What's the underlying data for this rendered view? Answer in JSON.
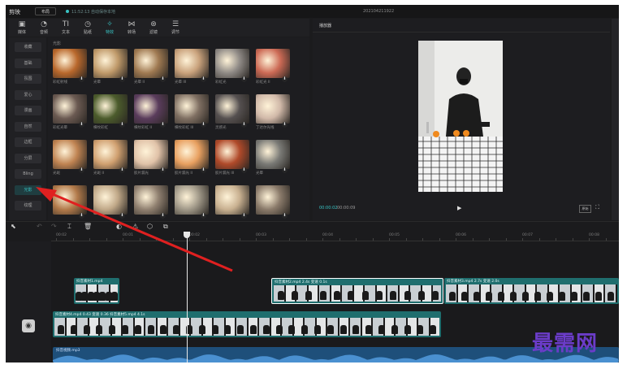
{
  "titlebar": {
    "app_name": "剪映",
    "layout_label": "布局",
    "autosave": "11:52:13 自动保存本地",
    "project_title": "202104211922"
  },
  "toolbar": {
    "tools": [
      {
        "label": "媒体",
        "icon": "media-icon",
        "glyph": "▣"
      },
      {
        "label": "音频",
        "icon": "audio-icon",
        "glyph": "◔"
      },
      {
        "label": "文本",
        "icon": "text-icon",
        "glyph": "TI"
      },
      {
        "label": "贴纸",
        "icon": "sticker-icon",
        "glyph": "◷"
      },
      {
        "label": "特效",
        "icon": "effects-icon",
        "glyph": "✧",
        "active": true
      },
      {
        "label": "转场",
        "icon": "transition-icon",
        "glyph": "⋈"
      },
      {
        "label": "滤镜",
        "icon": "filter-icon",
        "glyph": "⊛"
      },
      {
        "label": "调节",
        "icon": "adjust-icon",
        "glyph": "☰"
      }
    ]
  },
  "sidebar": {
    "items": [
      "收藏",
      "基础",
      "氛围",
      "爱心",
      "漫画",
      "自然",
      "边框",
      "分屏",
      "Bling",
      "光影",
      "纹理"
    ],
    "active": "光影"
  },
  "effects": {
    "section": "光影",
    "items": [
      {
        "label": "彩虹射线",
        "color": "#b9682c"
      },
      {
        "label": "光晕",
        "color": "#c09a6a"
      },
      {
        "label": "光晕 II",
        "color": "#a07a52"
      },
      {
        "label": "光晕 III",
        "color": "#c9a27c"
      },
      {
        "label": "彩虹光",
        "color": "#8f8a86"
      },
      {
        "label": "彩虹光 II",
        "color": "#cc6a55"
      },
      {
        "label": "彩虹光晕",
        "color": "#6b5a52"
      },
      {
        "label": "横纹彩虹",
        "color": "#4c5c2c"
      },
      {
        "label": "横纹彩虹 II",
        "color": "#5a3c5c"
      },
      {
        "label": "横纹彩虹 III",
        "color": "#7f6f62"
      },
      {
        "label": "灵感光",
        "color": "#555050"
      },
      {
        "label": "丁达尔光线",
        "color": "#d0b8a8"
      },
      {
        "label": "光斑",
        "color": "#c08452"
      },
      {
        "label": "光斑 II",
        "color": "#d0a070"
      },
      {
        "label": "胶片漏光",
        "color": "#e0c2a8"
      },
      {
        "label": "胶片漏光 II",
        "color": "#e8a060"
      },
      {
        "label": "胶片漏光 III",
        "color": "#b04a2a"
      },
      {
        "label": "光晕",
        "color": "#7a7a76"
      },
      {
        "label": "",
        "color": "#b27a4a"
      },
      {
        "label": "",
        "color": "#c0a888"
      },
      {
        "label": "",
        "color": "#908070"
      },
      {
        "label": "",
        "color": "#a09888"
      },
      {
        "label": "",
        "color": "#c8b090"
      },
      {
        "label": "",
        "color": "#8a7a6a"
      }
    ]
  },
  "player": {
    "title": "播放器",
    "current_time": "00:00:02",
    "total_time": "00:00:09",
    "ratio_label": "原始"
  },
  "timeline": {
    "ruler": [
      "00:02",
      "00:01",
      "00:02",
      "00:03",
      "00:04",
      "00:05",
      "00:06",
      "00:07",
      "00:08"
    ],
    "main_clips": [
      {
        "label": "抖音素材1.mp4",
        "frames": 7
      },
      {
        "label": "抖音素材2.mp4  2.4s  变速 0.1s",
        "frames": 12,
        "selected": true
      },
      {
        "label": "抖音素材3.mp4  2.7s  变速 2.0s",
        "frames": 14
      }
    ],
    "lower_clip": {
      "label": "抖音素材4.mp4  0.43  变速  0.36  抖音素材5.mp4  4.1s",
      "frames": 30
    },
    "audio_clip": "抖音视频.mp3"
  },
  "watermark": "最需网"
}
